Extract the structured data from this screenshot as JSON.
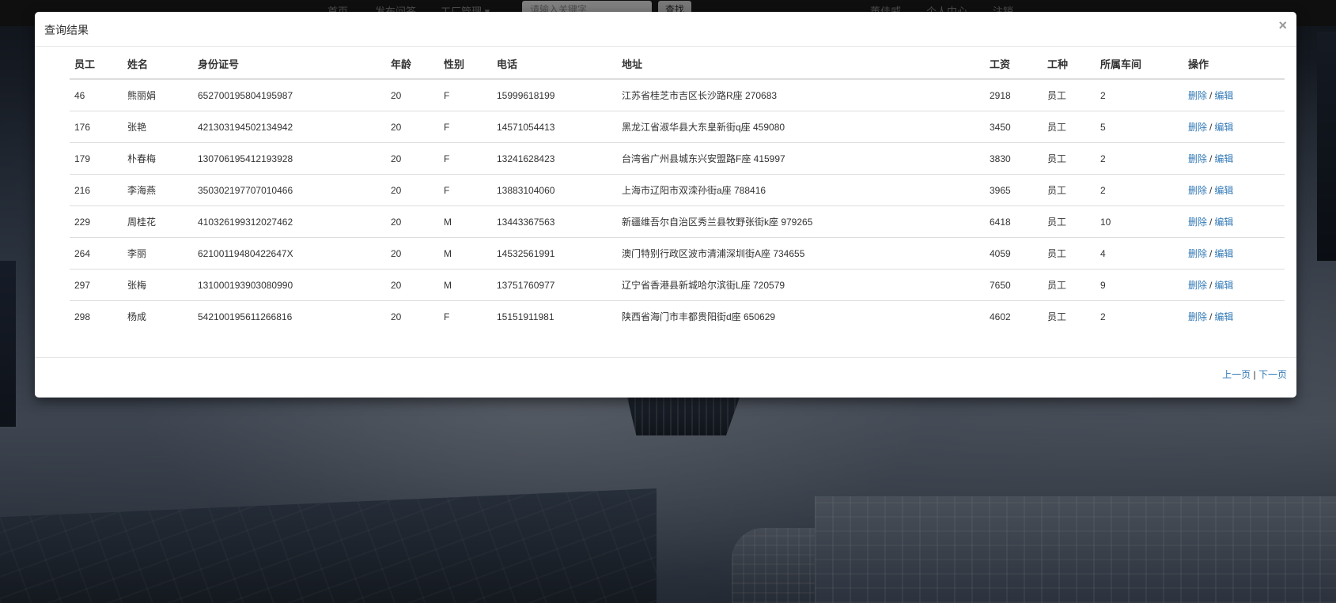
{
  "navbar": {
    "items": [
      "首页",
      "发布问答",
      "工厂管理 ▾"
    ],
    "search_placeholder": "请输入关键字",
    "search_button": "查找",
    "user": "董佳威",
    "profile": "个人中心",
    "logout": "注销"
  },
  "modal": {
    "title": "查询结果",
    "close": "×"
  },
  "table": {
    "headers": [
      "员工",
      "姓名",
      "身份证号",
      "年龄",
      "性别",
      "电话",
      "地址",
      "工资",
      "工种",
      "所属车间",
      "操作"
    ],
    "rows": [
      [
        "46",
        "熊丽娟",
        "652700195804195987",
        "20",
        "F",
        "15999618199",
        "江苏省桂芝市吉区长沙路R座 270683",
        "2918",
        "员工",
        "2"
      ],
      [
        "176",
        "张艳",
        "421303194502134942",
        "20",
        "F",
        "14571054413",
        "黑龙江省淑华县大东皇新街q座 459080",
        "3450",
        "员工",
        "5"
      ],
      [
        "179",
        "朴春梅",
        "130706195412193928",
        "20",
        "F",
        "13241628423",
        "台湾省广州县城东兴安盟路F座 415997",
        "3830",
        "员工",
        "2"
      ],
      [
        "216",
        "李海燕",
        "350302197707010466",
        "20",
        "F",
        "13883104060",
        "上海市辽阳市双滦孙街a座 788416",
        "3965",
        "员工",
        "2"
      ],
      [
        "229",
        "周桂花",
        "410326199312027462",
        "20",
        "M",
        "13443367563",
        "新疆维吾尔自治区秀兰县牧野张街k座 979265",
        "6418",
        "员工",
        "10"
      ],
      [
        "264",
        "李丽",
        "62100119480422647X",
        "20",
        "M",
        "14532561991",
        "澳门特别行政区波市清浦深圳街A座 734655",
        "4059",
        "员工",
        "4"
      ],
      [
        "297",
        "张梅",
        "131000193903080990",
        "20",
        "M",
        "13751760977",
        "辽宁省香港县新城哈尔滨街L座 720579",
        "7650",
        "员工",
        "9"
      ],
      [
        "298",
        "杨成",
        "542100195611266816",
        "20",
        "F",
        "15151911981",
        "陕西省海门市丰都贵阳街d座 650629",
        "4602",
        "员工",
        "2"
      ]
    ],
    "action_delete": "删除",
    "action_sep": "/",
    "action_edit": "编辑"
  },
  "pager": {
    "prev": "上一页",
    "sep": "|",
    "next": "下一页"
  }
}
